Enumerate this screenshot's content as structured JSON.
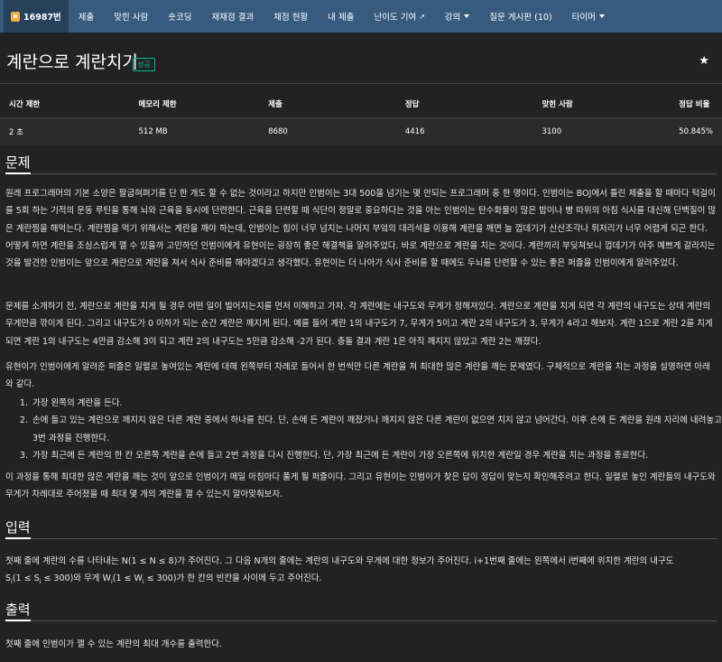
{
  "nav": {
    "brand": "16987번",
    "items": [
      {
        "label": "제출"
      },
      {
        "label": "맞힌 사람"
      },
      {
        "label": "숏코딩"
      },
      {
        "label": "재채점 결과"
      },
      {
        "label": "채점 현황"
      },
      {
        "label": "내 제출"
      },
      {
        "label": "난이도 기여"
      },
      {
        "label": "강의"
      },
      {
        "label": "질문 게시판 (10)"
      },
      {
        "label": "타이머"
      }
    ]
  },
  "problem": {
    "title": "계란으로 계란치기",
    "result_label": "성공",
    "star": "★"
  },
  "info_table": {
    "headers": [
      "시간 제한",
      "메모리 제한",
      "제출",
      "정답",
      "맞힌 사람",
      "정답 비율"
    ],
    "values": [
      "2 초",
      "512 MB",
      "8680",
      "4416",
      "3100",
      "50.845%"
    ]
  },
  "sections": {
    "description_title": "문제",
    "description": [
      "원래 프로그래머의 기본 소양은 팔굽혀펴기를 단 한 개도 할 수 없는 것이라고 하지만 인범이는 3대 500을 넘기는 몇 안되는 프로그래머 중 한 명이다. 인범이는 BOJ에서 틀린 제출을 할 때마다 턱걸이를 5회 하는 기적의 운동 루틴을 통해 뇌와 근육을 동시에 단련한다. 근육을 단련할 때 식단이 정말로 중요하다는 것을 아는 인범이는 탄수화물이 많은 밥이나 빵 따위의 아침 식사를 대신해 단백질이 많은 계란찜을 해먹는다. 계란찜을 먹기 위해서는 계란을 깨야 하는데, 인범이는 힘이 너무 넘치는 나머지 부엌의 대리석을 이용해 계란을 깨면 늘 껍데기가 산산조각나 튀처리가 너무 어렵게 되곤 한다. 어떻게 하면 계란을 조심스럽게 깰 수 있을까 고민하던 인범이에게 유현이는 굉장히 좋은 해결책을 알려주었다. 바로 계란으로 계란을 치는 것이다. 계란끼리 부딪쳐보니 껍데기가 아주 예쁘게 갈라지는 것을 발견한 인범이는 앞으로 계란으로 계란을 쳐서 식사 준비를 해야겠다고 생각했다. 유현이는 더 나아가 식사 준비를 할 때에도 두뇌를 단련할 수 있는 좋은 퍼즐을 인범이에게 알려주었다.",
      "문제를 소개하기 전, 계란으로 계란을 치게 될 경우 어떤 일이 벌어지는지를 먼저 이해하고 가자. 각 계란에는 내구도와 무게가 정해져있다. 계란으로 계란을 치게 되면 각 계란의 내구도는 상대 계란의 무게만큼 깎이게 된다. 그리고 내구도가 0 이하가 되는 순간 계란은 깨지게 된다. 예를 들어 계란 1의 내구도가 7, 무게가 5이고 계란 2의 내구도가 3, 무게가 4라고 해보자. 계란 1으로 계란 2를 치게 되면 계란 1의 내구도는 4만큼 감소해 3이 되고 계란 2의 내구도는 5만큼 감소해 -2가 된다. 충돌 결과 계란 1은 아직 깨지지 않았고 계란 2는 깨졌다.",
      "유현이가 인범이에게 알려준 퍼즐은 일렬로 놓여있는 계란에 대해 왼쪽부터 차례로 들어서 한 번씩만 다른 계란을 쳐 최대한 많은 계란을 깨는 문제였다. 구체적으로 계란을 치는 과정을 설명하면 아래와 같다."
    ],
    "steps": [
      "가장 왼쪽의 계란을 든다.",
      "손에 들고 있는 계란으로 깨지지 않은 다른 계란 중에서 하나를 친다. 단, 손에 든 계란이 깨졌거나 깨지지 않은 다른 계란이 없으면 치지 않고 넘어간다. 이후 손에 든 계란을 원래 자리에 내려놓고 3번 과정을 진행한다.",
      "가장 최근에 든 계란의 한 칸 오른쪽 계란을 손에 들고 2번 과정을 다시 진행한다. 단, 가장 최근에 든 계란이 가장 오른쪽에 위치한 계란일 경우 계란을 치는 과정을 종료한다."
    ],
    "closing": "이 과정을 통해 최대한 많은 계란을 깨는 것이 앞으로 인범이가 매일 아침마다 풀게 될 퍼즐이다. 그리고 유현이는 인범이가 찾은 답이 정답이 맞는지 확인해주려고 한다. 일렬로 놓인 계란들의 내구도와 무게가 차례대로 주어졌을 때 최대 몇 개의 계란을 깰 수 있는지 알아맞춰보자.",
    "input_title": "입력",
    "input_line1": "첫째 줄에 계란의 수를 나타내는 N(1 ≤ N ≤ 8)가 주어진다. 그 다음 N개의 줄에는 계란의 내구도와 무게에 대한 정보가 주어진다. i+1번째 줄에는 왼쪽에서 i번째에 위치한 계란의 내구도",
    "input_line2_a": "S",
    "input_line2_sub1": "i",
    "input_line2_b": "(1 ≤ S",
    "input_line2_sub2": "i",
    "input_line2_c": " ≤ 300)와 무게 W",
    "input_line2_sub3": "i",
    "input_line2_d": "(1 ≤ W",
    "input_line2_sub4": "i",
    "input_line2_e": " ≤ 300)가 한 칸의 빈칸을 사이에 두고 주어진다.",
    "output_title": "출력",
    "output_text": "첫째 줄에 인범이가 깰 수 있는 계란의 최대 개수를 출력한다."
  }
}
